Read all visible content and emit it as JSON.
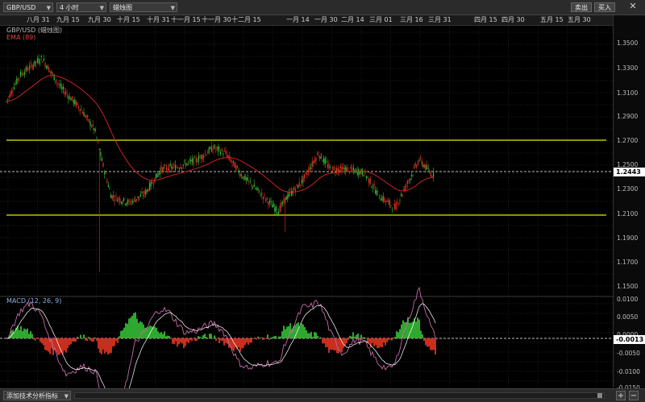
{
  "toolbar": {
    "symbol": "GBP/USD",
    "timeframe": "4 小时",
    "chart_type": "蜡烛图",
    "sell_label": "卖出",
    "buy_label": "买入",
    "close_glyph": "✕"
  },
  "dates": [
    "八月 31",
    "九月 15",
    "九月 30",
    "十月 15",
    "十月 31",
    "十一月 15",
    "十一月 30",
    "十二月 15",
    "一月 14",
    "一月 30",
    "二月 14",
    "三月 01",
    "三月 16",
    "三月 31",
    "四月 15",
    "四月 30",
    "五月 15",
    "五月 30"
  ],
  "price_chart": {
    "legend_title": "GBP/USD (蜡烛图)",
    "legend_ema": "EMA (89)",
    "ticks": [
      "1.3500",
      "1.3300",
      "1.3100",
      "1.2900",
      "1.2700",
      "1.2500",
      "1.2300",
      "1.2100",
      "1.1900",
      "1.1700",
      "1.1500"
    ],
    "current_price": "1.2443",
    "ema_color": "#cc2222",
    "support_resistance_color": "#e6e600"
  },
  "macd": {
    "legend": "MACD (12, 26, 9)",
    "ticks": [
      "0.0100",
      "0.0050",
      "0.0000",
      "-0.0050",
      "-0.0100",
      "-0.0150"
    ],
    "current_value": "-0.0013",
    "line_color": "#c46aa8",
    "signal_color": "#ffffff"
  },
  "footer": {
    "indicator_select": "添加技术分析指标",
    "zoom_in": "+",
    "zoom_out": "−"
  }
}
